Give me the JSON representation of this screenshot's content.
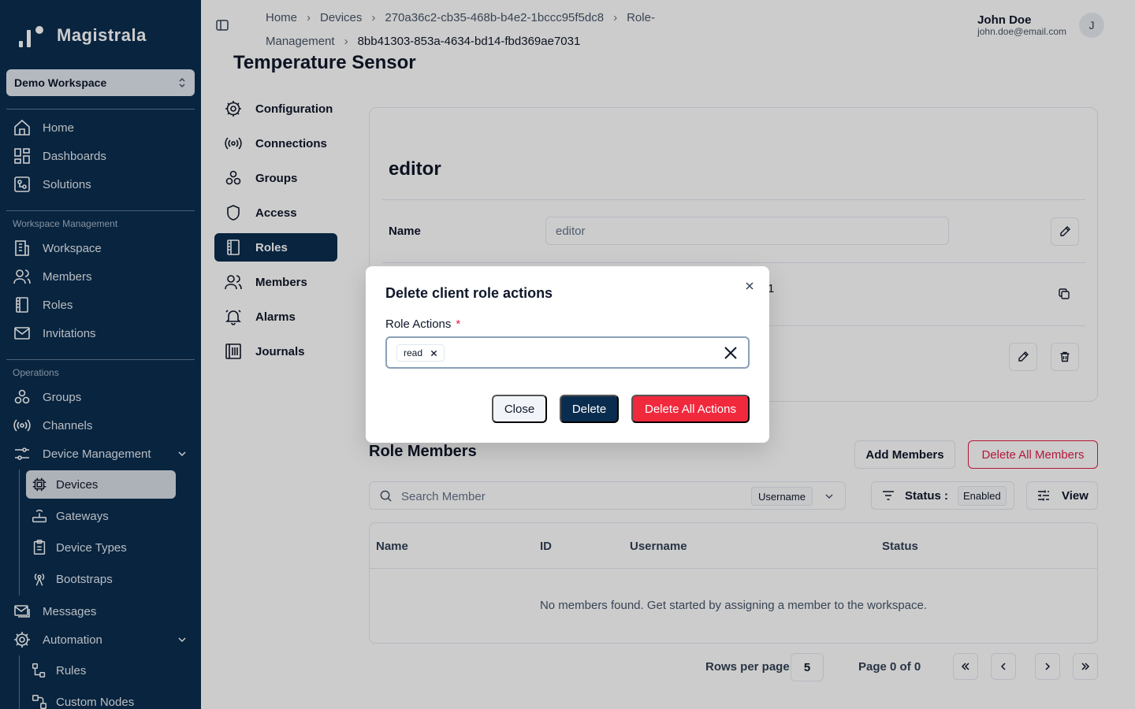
{
  "app": {
    "name": "Magistrala",
    "workspace": "Demo Workspace"
  },
  "sidebar": {
    "top_items": [
      {
        "label": "Home",
        "icon": "home-icon"
      },
      {
        "label": "Dashboards",
        "icon": "dashboard-icon"
      },
      {
        "label": "Solutions",
        "icon": "solutions-icon"
      }
    ],
    "workspace_heading": "Workspace Management",
    "workspace_items": [
      {
        "label": "Workspace",
        "icon": "building-icon"
      },
      {
        "label": "Members",
        "icon": "users-icon"
      },
      {
        "label": "Roles",
        "icon": "book-icon"
      },
      {
        "label": "Invitations",
        "icon": "mail-icon"
      }
    ],
    "operations_heading": "Operations",
    "operations_items": [
      {
        "label": "Groups",
        "icon": "groups-icon"
      },
      {
        "label": "Channels",
        "icon": "radio-icon"
      },
      {
        "label": "Device Management",
        "icon": "sliders-icon"
      }
    ],
    "device_sub_items": [
      {
        "label": "Devices",
        "icon": "chip-icon"
      },
      {
        "label": "Gateways",
        "icon": "router-icon"
      },
      {
        "label": "Device Types",
        "icon": "clipboard-icon"
      },
      {
        "label": "Bootstraps",
        "icon": "antenna-icon"
      }
    ],
    "lower_items": [
      {
        "label": "Messages",
        "icon": "messages-icon"
      },
      {
        "label": "Automation",
        "icon": "gear-icon"
      }
    ],
    "automation_sub_items": [
      {
        "label": "Rules",
        "icon": "rules-icon"
      },
      {
        "label": "Custom Nodes",
        "icon": "nodes-icon"
      }
    ]
  },
  "breadcrumb": {
    "items": [
      "Home",
      "Devices",
      "270a36c2-cb35-468b-b4e2-1bccc95f5dc8",
      "Role-Management"
    ],
    "current": "8bb41303-853a-4634-bd14-fbd369ae7031"
  },
  "user": {
    "name": "John Doe",
    "email": "john.doe@email.com",
    "initial": "J"
  },
  "page": {
    "title": "Temperature Sensor"
  },
  "secondary_nav": [
    {
      "label": "Configuration",
      "icon": "gear-icon"
    },
    {
      "label": "Connections",
      "icon": "radio-icon"
    },
    {
      "label": "Groups",
      "icon": "groups-icon"
    },
    {
      "label": "Access",
      "icon": "shield-icon"
    },
    {
      "label": "Roles",
      "icon": "book-icon"
    },
    {
      "label": "Members",
      "icon": "users-icon"
    },
    {
      "label": "Alarms",
      "icon": "bell-icon"
    },
    {
      "label": "Journals",
      "icon": "journal-icon"
    }
  ],
  "role": {
    "title": "editor",
    "name_label": "Name",
    "name_value": "editor",
    "partial_text": "1"
  },
  "members": {
    "title": "Role Members",
    "add_button": "Add Members",
    "delete_all_button": "Delete All Members",
    "search_placeholder": "Search Member",
    "search_field": "Username",
    "status_label": "Status :",
    "status_value": "Enabled",
    "view_button": "View",
    "columns": [
      "Name",
      "ID",
      "Username",
      "Status"
    ],
    "empty_message": "No members found. Get started by assigning a member to the workspace."
  },
  "pagination": {
    "rows_label": "Rows per page",
    "rows_value": "5",
    "page_label": "Page 0 of 0"
  },
  "modal": {
    "title": "Delete client role actions",
    "field_label": "Role Actions",
    "required_mark": "*",
    "chips": [
      "read"
    ],
    "close_button": "Close",
    "delete_button": "Delete",
    "delete_all_button": "Delete All Actions"
  },
  "colors": {
    "sidebar_bg": "#0a2d4f",
    "primary": "#0a2d4f",
    "danger": "#f1293d"
  }
}
